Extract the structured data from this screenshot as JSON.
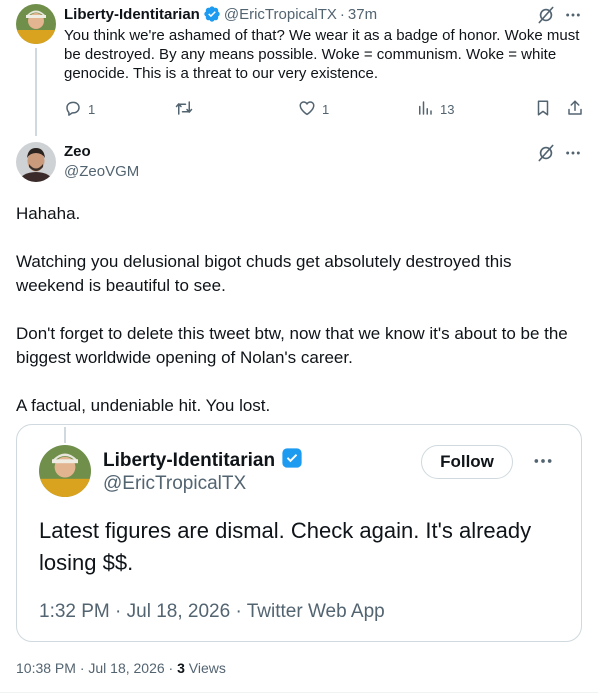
{
  "parent_tweet": {
    "name": "Liberty-Identitarian",
    "handle": "@EricTropicalTX",
    "separator": "·",
    "time": "37m",
    "text": "You think we're ashamed of that?  We wear it as a badge of honor. Woke must be destroyed.  By any means possible.  Woke = communism.  Woke = white genocide.  This is a threat to our very existence.",
    "replies": "1",
    "likes": "1",
    "views": "13",
    "icons": [
      "grok-icon",
      "more-icon",
      "reply-icon",
      "retweet-icon",
      "like-icon",
      "views-icon",
      "bookmark-icon",
      "share-icon"
    ]
  },
  "main_tweet": {
    "name": "Zeo",
    "handle": "@ZeoVGM",
    "paragraphs": [
      "Hahaha.",
      "Watching you delusional bigot chuds get absolutely destroyed this weekend is beautiful to see.",
      "Don't forget to delete this tweet btw, now that we know it's about to be the biggest worldwide opening of Nolan's career.",
      "A factual, undeniable hit. You lost."
    ],
    "timestamp": "10:38 PM · Jul 18, 2026 · ",
    "views_count": "3",
    "views_label": " Views"
  },
  "quote_tweet": {
    "name": "Liberty-Identitarian",
    "handle": "@EricTropicalTX",
    "follow_label": "Follow",
    "text": "Latest figures are dismal. Check again. It's already losing  $$.",
    "meta": "1:32 PM · Jul 18, 2026 · Twitter Web App"
  },
  "colors": {
    "verified": "#1d9bf0",
    "text": "#0f1419",
    "secondary": "#536471",
    "border": "#cfd9de"
  }
}
